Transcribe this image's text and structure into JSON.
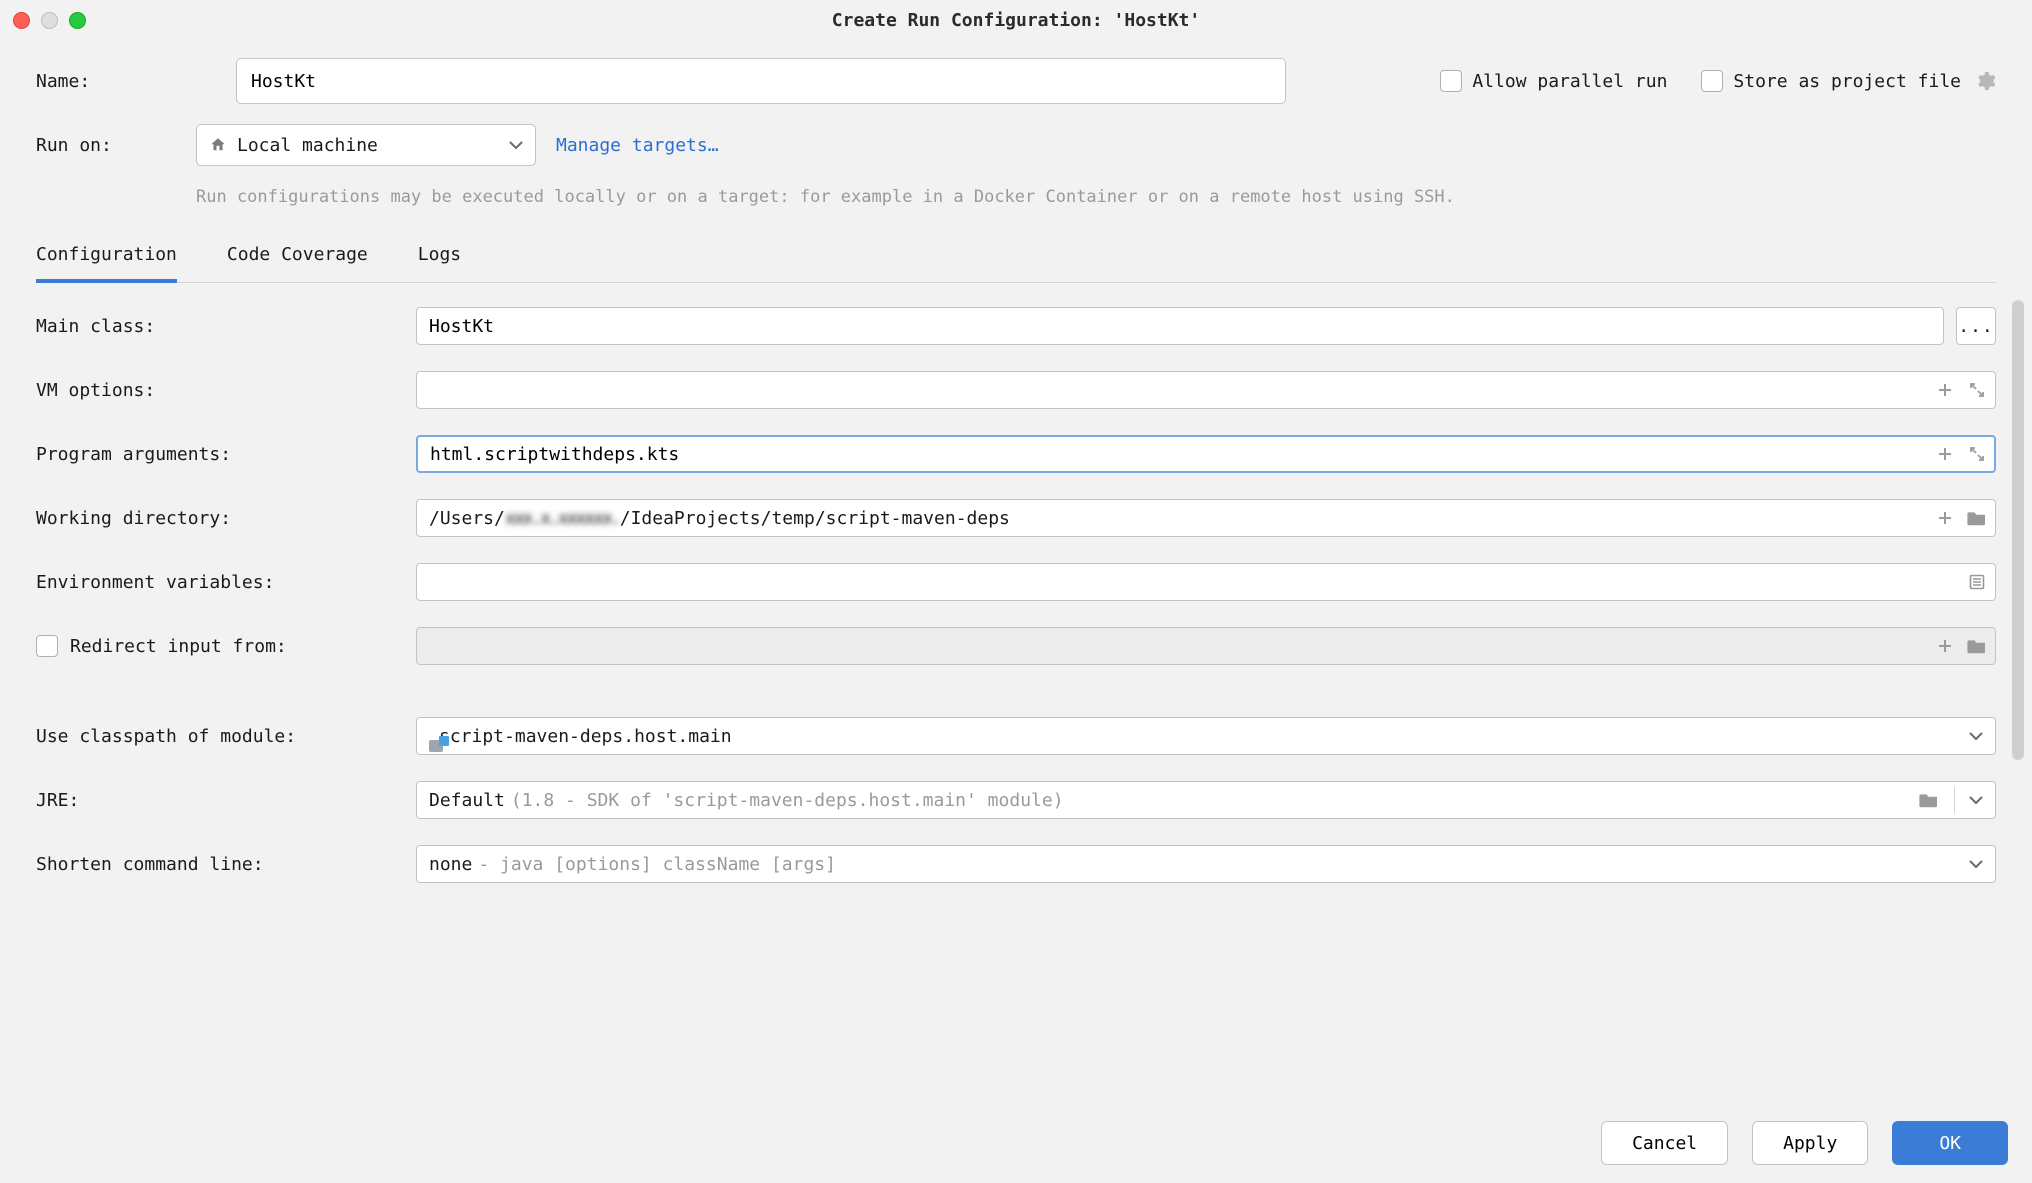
{
  "window": {
    "title": "Create Run Configuration: 'HostKt'"
  },
  "header": {
    "name_label": "Name:",
    "name_value": "HostKt",
    "allow_parallel_label": "Allow parallel run",
    "store_project_label": "Store as project file"
  },
  "runon": {
    "label": "Run on:",
    "value": "Local machine",
    "manage_link": "Manage targets…",
    "hint": "Run configurations may be executed locally or on a target: for example in a Docker Container or on a remote host using SSH."
  },
  "tabs": {
    "configuration": "Configuration",
    "code_coverage": "Code Coverage",
    "logs": "Logs"
  },
  "config": {
    "main_class_label": "Main class:",
    "main_class_value": "HostKt",
    "vm_options_label": "VM options:",
    "vm_options_value": "",
    "program_args_label": "Program arguments:",
    "program_args_value": "html.scriptwithdeps.kts",
    "working_dir_label": "Working directory:",
    "working_dir_prefix": "/Users/",
    "working_dir_masked": "xxx.x.xxxxxx.",
    "working_dir_suffix": "/IdeaProjects/temp/script-maven-deps",
    "env_vars_label": "Environment variables:",
    "env_vars_value": "",
    "redirect_input_label": "Redirect input from:",
    "redirect_input_value": "",
    "classpath_label": "Use classpath of module:",
    "classpath_value": "script-maven-deps.host.main",
    "jre_label": "JRE:",
    "jre_value": "Default",
    "jre_hint": "(1.8 - SDK of 'script-maven-deps.host.main' module)",
    "shorten_label": "Shorten command line:",
    "shorten_value": "none",
    "shorten_hint": "- java [options] className [args]"
  },
  "footer": {
    "cancel": "Cancel",
    "apply": "Apply",
    "ok": "OK"
  }
}
